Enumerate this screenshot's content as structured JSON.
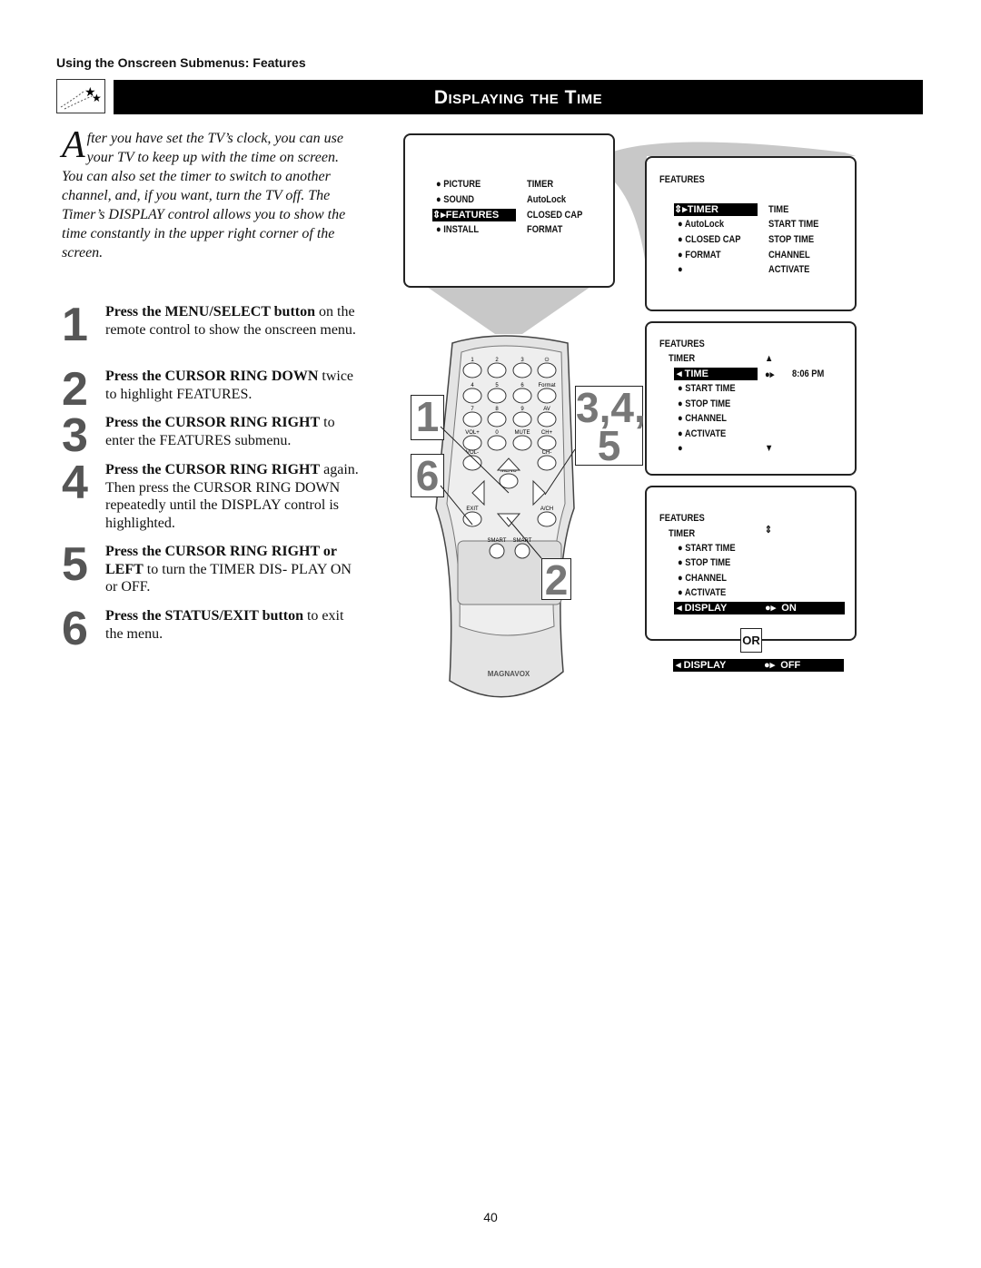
{
  "section_header": "Using the Onscreen Submenus: Features",
  "title": "Displaying the Time",
  "icon": "shooting-stars-icon",
  "intro": {
    "drop_cap": "A",
    "text": "fter you have set the TV’s clock, you can use your TV to keep up with the time on screen. You can also set the timer to switch to another channel, and, if you want, turn the TV off. The Timer’s DISPLAY control allows you to show the time constantly in the upper right corner of the screen."
  },
  "steps": [
    {
      "num": "1",
      "bold": "Press the MENU/SELECT button",
      "text": " on the remote control to show the onscreen menu."
    },
    {
      "num": "2",
      "bold": "Press the CURSOR RING DOWN",
      "text": " twice to highlight FEATURES."
    },
    {
      "num": "3",
      "bold": "Press the CURSOR RING RIGHT",
      "text": " to enter the FEATURES submenu."
    },
    {
      "num": "4",
      "bold": "Press the CURSOR RING RIGHT",
      "text": " again. Then press the CURSOR RING DOWN repeatedly until the DISPLAY control is highlighted."
    },
    {
      "num": "5",
      "bold": "Press the CURSOR RING RIGHT or LEFT",
      "text": " to turn the TIMER DIS- PLAY ON or OFF."
    },
    {
      "num": "6",
      "bold": "Press the STATUS/EXIT button",
      "text": " to exit the menu."
    }
  ],
  "screen1": {
    "left": [
      "PICTURE",
      "SOUND",
      "FEATURES",
      "INSTALL"
    ],
    "right": [
      "TIMER",
      "AutoLock",
      "CLOSED CAP",
      "FORMAT"
    ]
  },
  "screen2": {
    "title": "FEATURES",
    "left": [
      "TIMER",
      "AutoLock",
      "CLOSED CAP",
      "FORMAT",
      ""
    ],
    "right": [
      "TIME",
      "START TIME",
      "STOP TIME",
      "CHANNEL",
      "ACTIVATE"
    ]
  },
  "screen3": {
    "title": "FEATURES",
    "sub": "TIMER",
    "items": [
      "TIME",
      "START TIME",
      "STOP TIME",
      "CHANNEL",
      "ACTIVATE",
      ""
    ],
    "value": "8:06 PM"
  },
  "screen4": {
    "title": "FEATURES",
    "sub": "TIMER",
    "items": [
      "START TIME",
      "STOP TIME",
      "CHANNEL",
      "ACTIVATE"
    ],
    "display_label": "DISPLAY",
    "on": "ON"
  },
  "or_label": "OR",
  "display_off": {
    "label": "DISPLAY",
    "value": "OFF"
  },
  "remote": {
    "buttons": [
      "1",
      "2",
      "3",
      "⏻",
      "4",
      "5",
      "6",
      "Format",
      "7",
      "8",
      "9",
      "AV",
      "VOL+",
      "0",
      "MUTE",
      "CH+",
      "VOL-",
      "CH-",
      "MENU",
      "EXIT",
      "A/CH",
      "SMART",
      "SMART"
    ],
    "brand": "MAGNAVOX"
  },
  "callouts": [
    "1",
    "6",
    "3,4,\n5",
    "2"
  ],
  "page_number": "40"
}
